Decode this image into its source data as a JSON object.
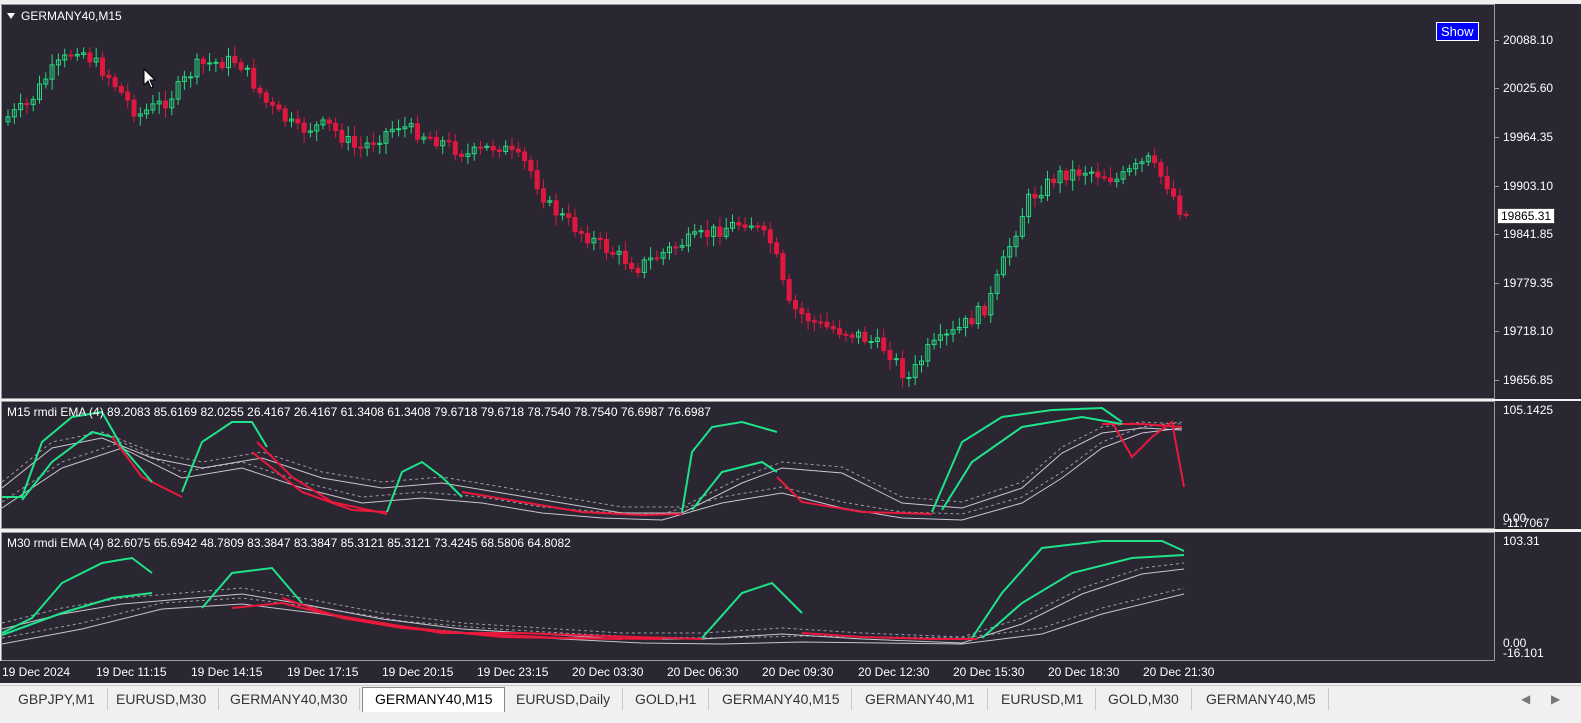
{
  "main_chart": {
    "title": "GERMANY40,M15",
    "show_button": "Show",
    "current_price": "19865.31",
    "price_labels": [
      "20088.10",
      "20025.60",
      "19964.35",
      "19903.10",
      "19841.85",
      "19779.35",
      "19718.10",
      "19656.85"
    ]
  },
  "m15_indicator": {
    "title": "M15 rmdi  EMA (4) 89.2083 85.6169 82.0255 26.4167 26.4167 61.3408 61.3408 79.6718 79.6718 78.7540 78.7540 76.6987 76.6987",
    "axis_labels": [
      "105.1425",
      "0.00",
      "-11.7067"
    ]
  },
  "m30_indicator": {
    "title": "M30 rmdi  EMA (4) 82.6075 65.6942 48.7809 83.3847 83.3847 85.3121 85.3121 73.4245 68.5806 64.8082",
    "axis_labels": [
      "103.31",
      "0.00",
      "-16.101"
    ]
  },
  "time_axis": [
    "19 Dec 2024",
    "19 Dec 11:15",
    "19 Dec 14:15",
    "19 Dec 17:15",
    "19 Dec 20:15",
    "19 Dec 23:15",
    "20 Dec 03:30",
    "20 Dec 06:30",
    "20 Dec 09:30",
    "20 Dec 12:30",
    "20 Dec 15:30",
    "20 Dec 18:30",
    "20 Dec 21:30"
  ],
  "tabs": [
    "GBPJPY,M1",
    "EURUSD,M30",
    "GERMANY40,M30",
    "GERMANY40,M15",
    "EURUSD,Daily",
    "GOLD,H1",
    "GERMANY40,M15",
    "GERMANY40,M1",
    "EURUSD,M1",
    "GOLD,M30",
    "GERMANY40,M5"
  ],
  "active_tab_index": 3,
  "colors": {
    "background": "#2a2632",
    "bull": "#26d97f",
    "bear": "#e0183f",
    "line_green": "#1ee38a",
    "line_red": "#e8193c"
  },
  "icons": {
    "tab_prev": "chevron-left-icon",
    "tab_next": "chevron-right-icon",
    "cursor": "mouse-pointer-icon",
    "collapse": "triangle-down-icon"
  }
}
